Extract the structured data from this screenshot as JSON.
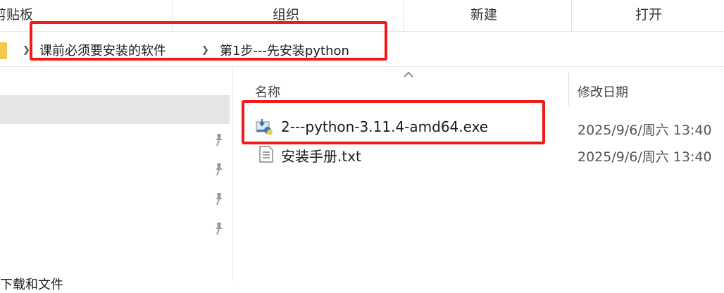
{
  "ribbon": {
    "groups": [
      "剪贴板",
      "组织",
      "新建",
      "打开"
    ]
  },
  "address": {
    "crumbs": [
      "课前必须要安装的软件",
      "第1步---先安装python"
    ]
  },
  "nav": {
    "partial_item": "下载和文件"
  },
  "list": {
    "columns": {
      "name": "名称",
      "date": "修改日期"
    },
    "rows": [
      {
        "name": "2---python-3.11.4-amd64.exe",
        "date": "2025/9/6/周六 13:40",
        "icon": "python-installer-icon"
      },
      {
        "name": "安装手册.txt",
        "date": "2025/9/6/周六 13:40",
        "icon": "text-file-icon"
      }
    ]
  },
  "colors": {
    "highlight": "#f01a1a",
    "folder": "#f2c94c",
    "selection": "#e5e5e5"
  }
}
